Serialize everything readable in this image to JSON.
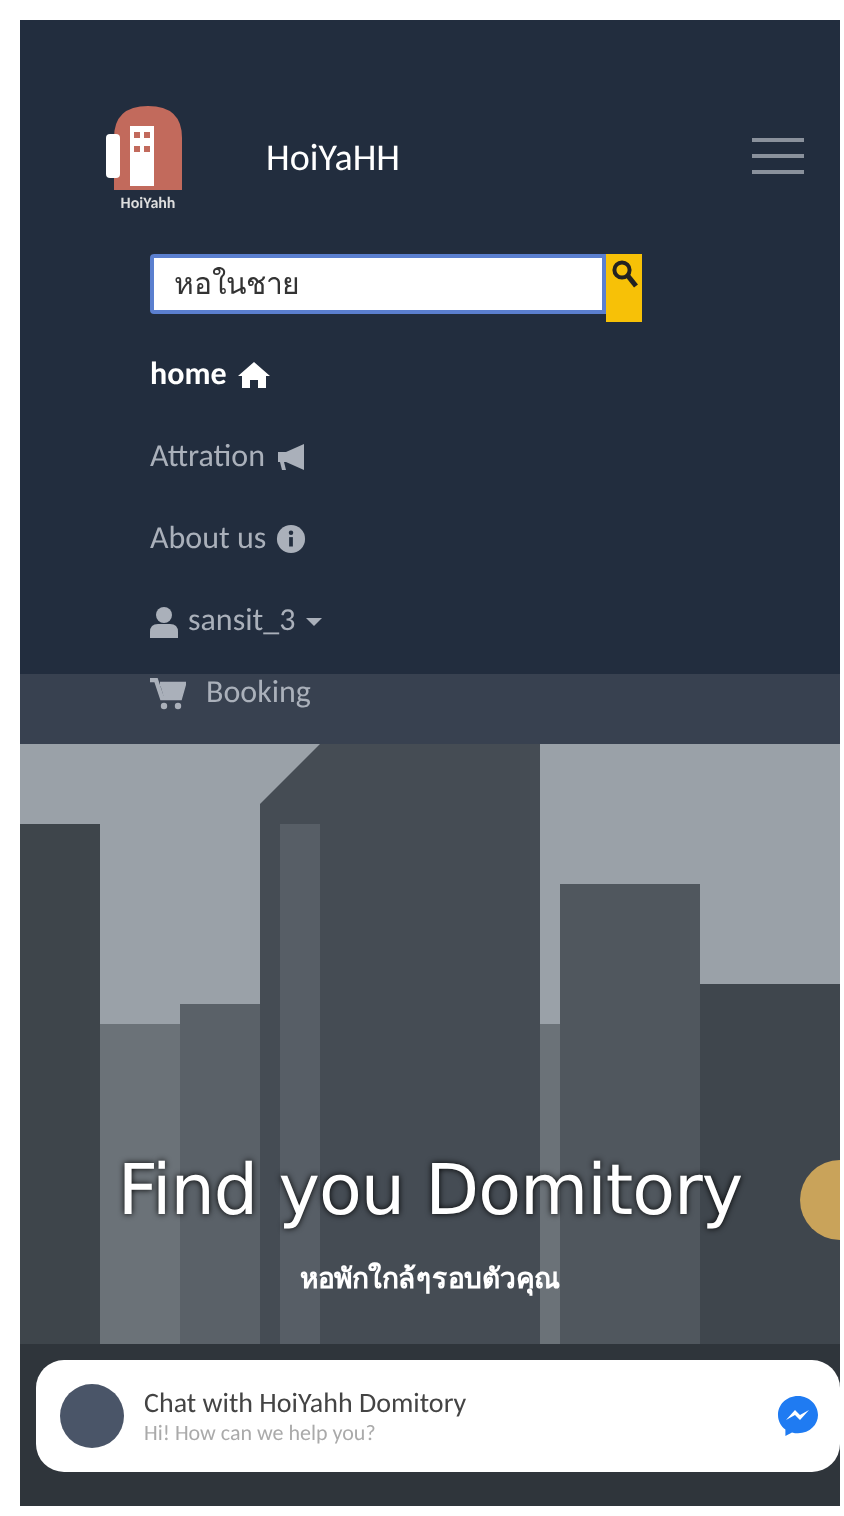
{
  "brand": {
    "logo_caption": "HoiYahh",
    "title": "HoiYaHH"
  },
  "search": {
    "value": "หอในชาย"
  },
  "nav_items": [
    {
      "label": "home",
      "selected": true,
      "dropdown": false
    },
    {
      "label": "Attration",
      "selected": false,
      "dropdown": false
    },
    {
      "label": "About us",
      "selected": false,
      "dropdown": false
    },
    {
      "label": "sansit_3",
      "selected": false,
      "dropdown": true
    },
    {
      "label": "Booking",
      "selected": false,
      "dropdown": false
    }
  ],
  "hero": {
    "title": "Find you Domitory",
    "subtitle": "หอพักใกล้ๆรอบตัวคุณ"
  },
  "chat": {
    "title": "Chat with HoiYahh Domitory",
    "message": "Hi! How can we help you?"
  }
}
